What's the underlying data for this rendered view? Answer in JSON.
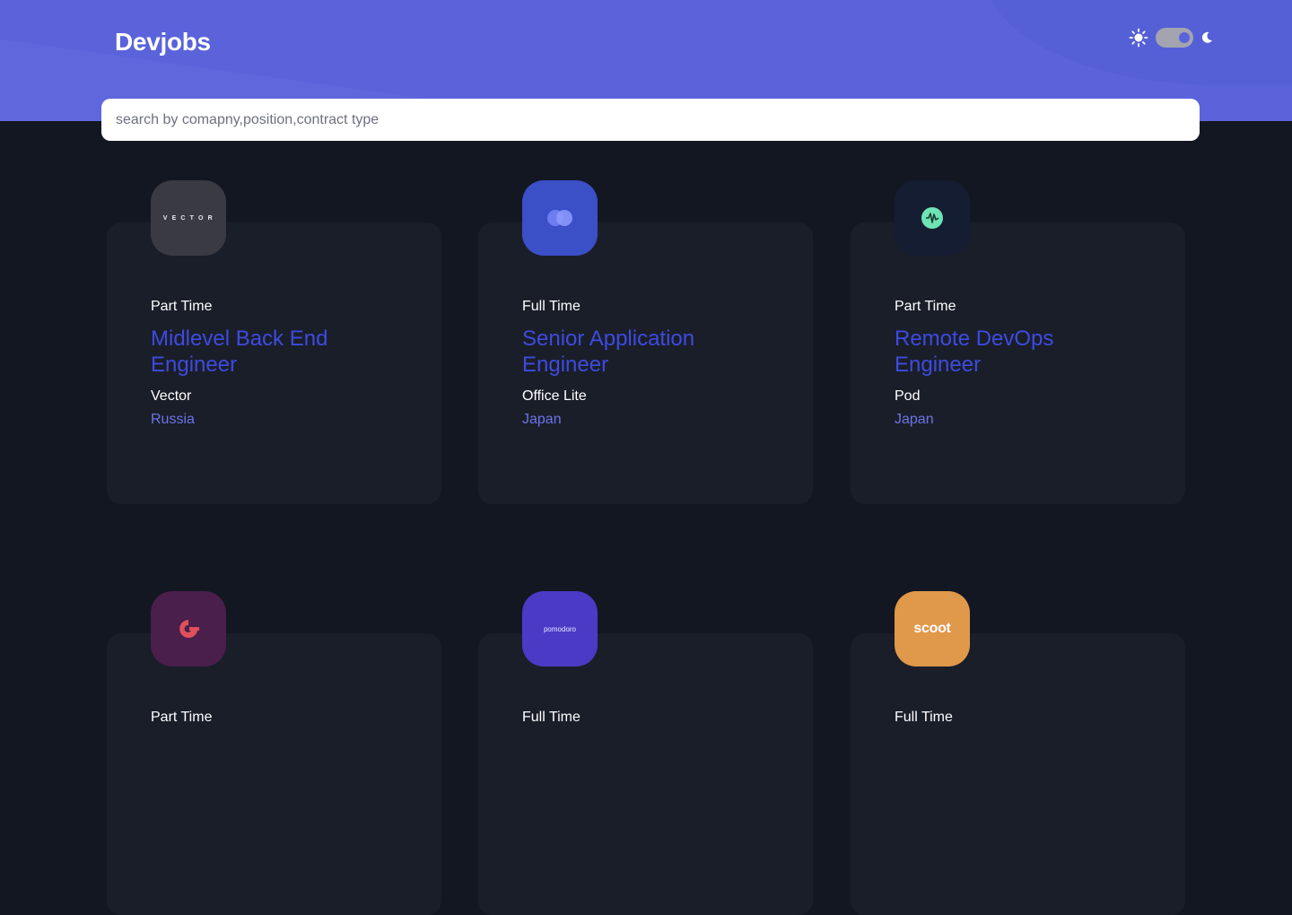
{
  "app": {
    "logo": "Devjobs"
  },
  "theme_toggle": {
    "sun_icon": "sun-icon",
    "moon_icon": "moon-icon",
    "mode": "dark"
  },
  "search": {
    "placeholder": "search by comapny,position,contract type",
    "value": ""
  },
  "colors": {
    "header": "#5b63db",
    "background": "#131722",
    "card": "#1a1e29",
    "position_text": "#3d4be0",
    "location_text": "#6c74e6"
  },
  "jobs": [
    {
      "contract": "Part Time",
      "position": "Midlevel Back End Engineer",
      "company": "Vector",
      "location": "Russia",
      "logo_text": "VECTOR",
      "logo_color": "#3a3a42"
    },
    {
      "contract": "Full Time",
      "position": "Senior Application Engineer",
      "company": "Office Lite",
      "location": "Japan",
      "logo_text": "",
      "logo_color": "#3b4fc7"
    },
    {
      "contract": "Part Time",
      "position": "Remote DevOps Engineer",
      "company": "Pod",
      "location": "Japan",
      "logo_text": "",
      "logo_color": "#151d33"
    },
    {
      "contract": "Part Time",
      "position": "",
      "company": "",
      "location": "",
      "logo_text": "",
      "logo_color": "#4a1f4b"
    },
    {
      "contract": "Full Time",
      "position": "",
      "company": "",
      "location": "",
      "logo_text": "pomodoro",
      "logo_color": "#4a3ac6"
    },
    {
      "contract": "Full Time",
      "position": "",
      "company": "",
      "location": "",
      "logo_text": "scoot",
      "logo_color": "#e0984a"
    }
  ]
}
